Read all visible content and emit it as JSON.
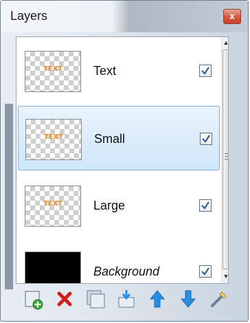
{
  "window": {
    "title": "Layers",
    "close_label": "x"
  },
  "layers": [
    {
      "name": "Text",
      "thumb_text": "TEXT",
      "visible": true,
      "selected": false,
      "italic": false
    },
    {
      "name": "Small",
      "thumb_text": "TEXT",
      "visible": true,
      "selected": true,
      "italic": false
    },
    {
      "name": "Large",
      "thumb_text": "TEXT",
      "visible": true,
      "selected": false,
      "italic": false
    },
    {
      "name": "Background",
      "thumb_text": "",
      "visible": true,
      "selected": false,
      "italic": true
    }
  ],
  "toolbar": {
    "icons": [
      "add-layer-icon",
      "delete-layer-icon",
      "duplicate-layer-icon",
      "merge-layer-down-icon",
      "move-layer-up-icon",
      "move-layer-down-icon",
      "layer-properties-icon"
    ]
  },
  "colors": {
    "accent": "#84acd4",
    "delete": "#d21e1e",
    "arrow": "#2a8de0"
  }
}
